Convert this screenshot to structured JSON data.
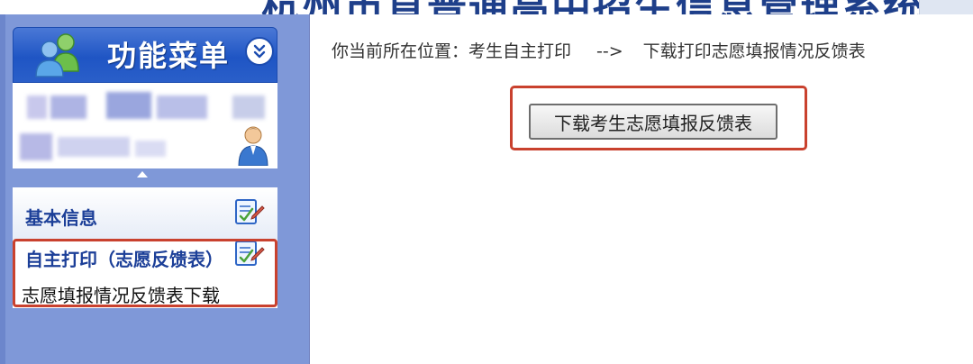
{
  "header": {
    "system_title": "杭州市直普通高中招生信息管理系统"
  },
  "sidebar": {
    "menu_title": "功能菜单",
    "collapse_icon": "chevron-double-down-icon",
    "nav": [
      {
        "label": "基本信息",
        "icon": "edit-form-icon"
      },
      {
        "label": "自主打印（志愿反馈表）",
        "icon": "edit-form-icon",
        "sub_items": [
          {
            "label": "志愿填报情况反馈表下载"
          }
        ]
      }
    ]
  },
  "main": {
    "breadcrumb_prefix": "你当前所在位置：",
    "breadcrumb_section": "考生自主打印",
    "breadcrumb_separator": "-->",
    "breadcrumb_page": "下载打印志愿填报情况反馈表",
    "download_button": "下载考生志愿填报反馈表"
  },
  "colors": {
    "sidebar_bg": "#7f98d8",
    "menu_header": "#1f55c4",
    "nav_text": "#1c3f98",
    "highlight": "#c9412e"
  }
}
